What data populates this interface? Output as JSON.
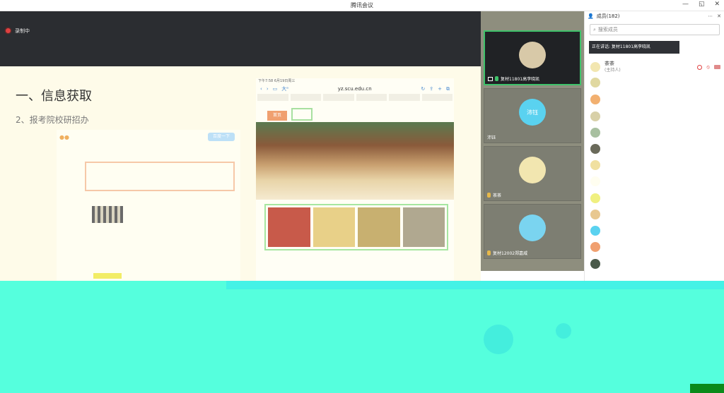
{
  "window": {
    "title": "腾讯会议",
    "controls": [
      "—",
      "◱",
      "✕"
    ]
  },
  "recording": {
    "label": "录制中",
    "color": "#e04040"
  },
  "slide": {
    "title": "一、信息获取",
    "subtitle": "2、报考院校研招办",
    "phone_shot": {
      "button_label": "百度一下"
    },
    "browser": {
      "status_time": "下午7:58  6月19日周三",
      "url": "yz.scu.edu.cn",
      "address_prefix": "大ᵃ",
      "nav_label": "首页"
    }
  },
  "gallery": {
    "tiles": [
      {
        "name": "复材11801高李晓凯",
        "speaking": true,
        "avatar_color": "#d8c9a8",
        "icon": "screen-share-icon"
      },
      {
        "name": "沛钰",
        "speaking": false,
        "avatar_color": "#5ad2f0",
        "avatar_text": "沛钰"
      },
      {
        "name": "茶茶",
        "speaking": false,
        "avatar_color": "#f2e6b0",
        "icon": "mic-icon"
      },
      {
        "name": "复材12002郑嘉威",
        "speaking": false,
        "avatar_color": "#7ad4f0",
        "icon": "mic-icon"
      }
    ]
  },
  "members": {
    "title": "成员(182)",
    "search_placeholder": "搜索成员",
    "speaking_tip": "正在讲话: 复材11801高李晓凯",
    "host": {
      "name": "茶茶",
      "role": "(主持人)",
      "rec_color": "#e04040"
    },
    "avatar_colors": [
      "#e0d8a0",
      "#f2b070",
      "#d8d0a8",
      "#a8c0a0",
      "#6a6a5a",
      "#f0e0a0",
      "#f0f080",
      "#e8c890",
      "#5ad2f0",
      "#f0a070",
      "#4a5a4a"
    ]
  }
}
